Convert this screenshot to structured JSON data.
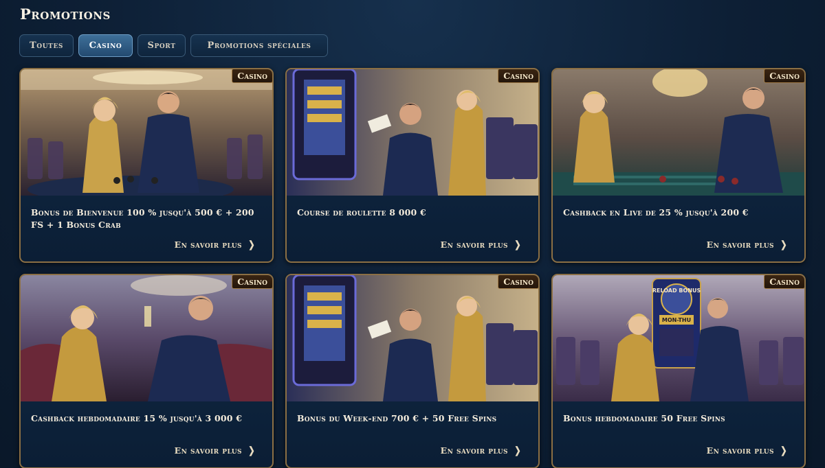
{
  "page": {
    "title": "Promotions"
  },
  "tabs": [
    {
      "label": "Toutes",
      "active": false
    },
    {
      "label": "Casino",
      "active": true
    },
    {
      "label": "Sport",
      "active": false
    },
    {
      "label": "Promotions spéciales",
      "active": false
    }
  ],
  "cards": [
    {
      "badge": "Casino",
      "title": "Bonus de Bienvenue 100 % jusqu'à 500 € + 200 FS + 1 Bonus Crab",
      "link": "En savoir plus",
      "scene": "poker-table"
    },
    {
      "badge": "Casino",
      "title": "Course de roulette 8 000 €",
      "link": "En savoir plus",
      "scene": "slot-machine"
    },
    {
      "badge": "Casino",
      "title": "Cashback en Live de 25 % jusqu'à 200 €",
      "link": "En savoir plus",
      "scene": "roulette-table"
    },
    {
      "badge": "Casino",
      "title": "Cashback hebdomadaire 15 % jusqu'à 3 000 €",
      "link": "En savoir plus",
      "scene": "lounge"
    },
    {
      "badge": "Casino",
      "title": "Bonus du Week-end 700 € + 50 Free Spins",
      "link": "En savoir plus",
      "scene": "slot-machine"
    },
    {
      "badge": "Casino",
      "title": "Bonus hebdomadaire 50 Free Spins",
      "link": "En savoir plus",
      "scene": "reload-bonus-machine",
      "machine_sign": "RELOAD BONUS",
      "machine_sub": "MON-THU"
    }
  ],
  "colors": {
    "accent_gold": "#8b6f44",
    "active_tab": "#3e6f99",
    "background": "#0d1f35"
  }
}
